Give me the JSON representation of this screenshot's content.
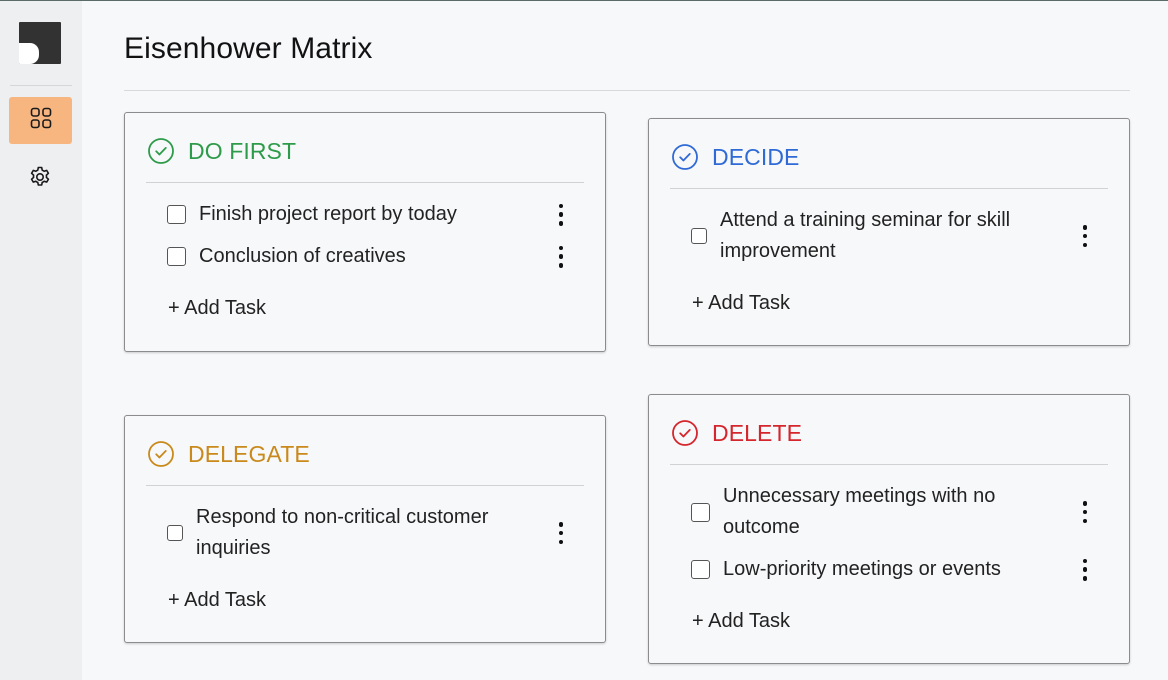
{
  "page": {
    "title": "Eisenhower Matrix"
  },
  "sidebar": {
    "logo_icon": "logo-mark",
    "items": [
      {
        "icon": "grid-icon",
        "active": true
      },
      {
        "icon": "gear-icon",
        "active": false
      }
    ],
    "active_color": "#f7b680"
  },
  "quadrants": [
    {
      "key": "do_first",
      "title": "DO FIRST",
      "color": "#2e9b4a",
      "tasks": [
        "Finish project report by today",
        "Conclusion of creatives"
      ],
      "add_label": "+ Add Task"
    },
    {
      "key": "decide",
      "title": "DECIDE",
      "color": "#2f6ad6",
      "tasks": [
        "Attend a training seminar for skill improvement"
      ],
      "add_label": "+ Add Task"
    },
    {
      "key": "delegate",
      "title": "DELEGATE",
      "color": "#c98a1b",
      "tasks": [
        "Respond to non-critical customer inquiries"
      ],
      "add_label": "+ Add Task"
    },
    {
      "key": "delete",
      "title": "DELETE",
      "color": "#d4262c",
      "tasks": [
        "Unnecessary meetings with no outcome",
        "Low-priority meetings or events"
      ],
      "add_label": "+ Add Task"
    }
  ]
}
